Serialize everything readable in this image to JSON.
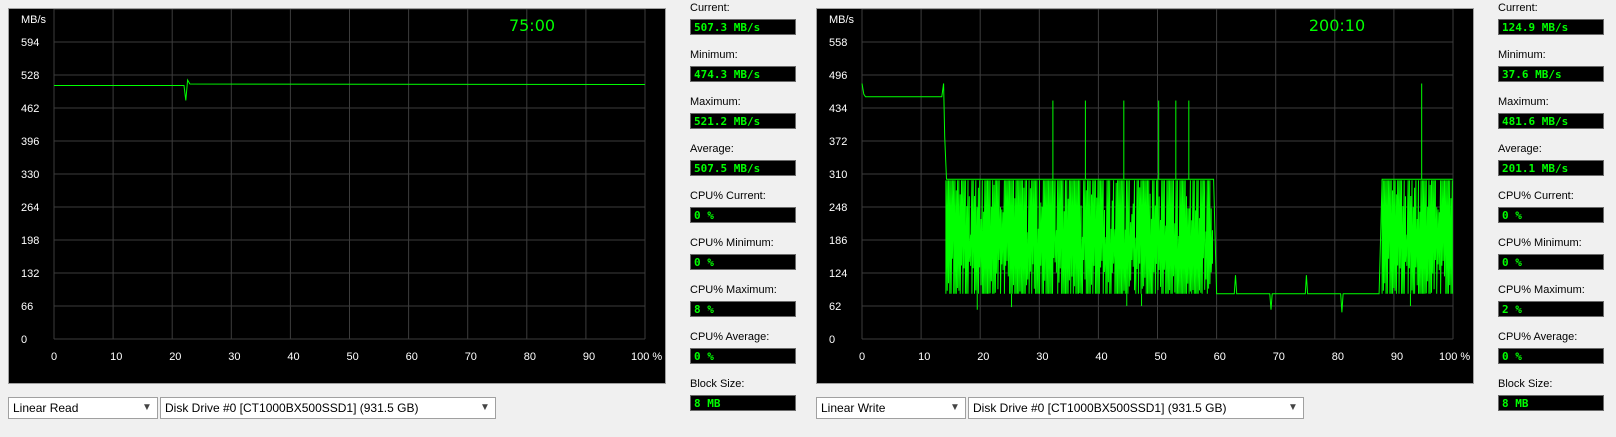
{
  "panels": [
    {
      "timer": "75:00",
      "unit_label": "MB/s",
      "mode": "Linear Read",
      "drive": "Disk Drive #0  [CT1000BX500SSD1]  (931.5 GB)",
      "stats": [
        {
          "label": "Current:",
          "value": "507.3 MB/s"
        },
        {
          "label": "Minimum:",
          "value": "474.3 MB/s"
        },
        {
          "label": "Maximum:",
          "value": "521.2 MB/s"
        },
        {
          "label": "Average:",
          "value": "507.5 MB/s"
        },
        {
          "label": "CPU% Current:",
          "value": "0 %"
        },
        {
          "label": "CPU% Minimum:",
          "value": "0 %"
        },
        {
          "label": "CPU% Maximum:",
          "value": "8 %"
        },
        {
          "label": "CPU% Average:",
          "value": "0 %"
        },
        {
          "label": "Block Size:",
          "value": "8 MB"
        }
      ]
    },
    {
      "timer": "200:10",
      "unit_label": "MB/s",
      "mode": "Linear Write",
      "drive": "Disk Drive #0  [CT1000BX500SSD1]  (931.5 GB)",
      "stats": [
        {
          "label": "Current:",
          "value": "124.9 MB/s"
        },
        {
          "label": "Minimum:",
          "value": "37.6 MB/s"
        },
        {
          "label": "Maximum:",
          "value": "481.6 MB/s"
        },
        {
          "label": "Average:",
          "value": "201.1 MB/s"
        },
        {
          "label": "CPU% Current:",
          "value": "0 %"
        },
        {
          "label": "CPU% Minimum:",
          "value": "0 %"
        },
        {
          "label": "CPU% Maximum:",
          "value": "2 %"
        },
        {
          "label": "CPU% Average:",
          "value": "0 %"
        },
        {
          "label": "Block Size:",
          "value": "8 MB"
        }
      ]
    }
  ],
  "chart_data": [
    {
      "type": "line",
      "ylabel": "MB/s",
      "ylim": [
        0,
        660
      ],
      "yticks": [
        "0",
        "66",
        "132",
        "198",
        "264",
        "330",
        "396",
        "462",
        "528",
        "594"
      ],
      "xlim": [
        0,
        100
      ],
      "xticks": [
        "0",
        "10",
        "20",
        "30",
        "40",
        "50",
        "60",
        "70",
        "80",
        "90",
        "100 %"
      ],
      "grid": true,
      "line_color": "#00ff00",
      "series": [
        {
          "x": [
            0,
            22,
            22.3,
            22.6,
            23,
            100
          ],
          "y": [
            507,
            507,
            477,
            518,
            510,
            509
          ]
        }
      ]
    },
    {
      "type": "line",
      "ylabel": "MB/s",
      "ylim": [
        0,
        620
      ],
      "yticks": [
        "0",
        "62",
        "124",
        "186",
        "248",
        "310",
        "372",
        "434",
        "496",
        "558"
      ],
      "xlim": [
        0,
        100
      ],
      "xticks": [
        "0",
        "10",
        "20",
        "30",
        "40",
        "50",
        "60",
        "70",
        "80",
        "90",
        "100 %"
      ],
      "grid": true,
      "line_color": "#00ff00",
      "series": [
        {
          "x": [
            0,
            0.3,
            0.6,
            13.5,
            13.8,
            14,
            14.3,
            59.5,
            60,
            63,
            63.2,
            63.4,
            69,
            69.2,
            69.4,
            75,
            75.2,
            75.4,
            81,
            81.2,
            81.4,
            87.5,
            88,
            100
          ],
          "y": [
            480,
            460,
            455,
            455,
            480,
            380,
            300,
            300,
            85,
            85,
            120,
            85,
            85,
            55,
            85,
            85,
            120,
            85,
            85,
            50,
            85,
            85,
            300,
            300
          ]
        }
      ],
      "oscillating_regions": [
        {
          "x_from": 14.2,
          "x_to": 59.5,
          "low": 85,
          "high": 298
        },
        {
          "x_from": 88,
          "x_to": 100,
          "low": 85,
          "high": 298
        }
      ],
      "spikes": [
        {
          "x": 32.3,
          "y": 448
        },
        {
          "x": 37.8,
          "y": 448
        },
        {
          "x": 44.3,
          "y": 448
        },
        {
          "x": 50.2,
          "y": 448
        },
        {
          "x": 53.1,
          "y": 448
        },
        {
          "x": 55.3,
          "y": 448
        },
        {
          "x": 94.7,
          "y": 480
        }
      ],
      "dips": [
        {
          "x": 19.5,
          "y": 55
        },
        {
          "x": 25.3,
          "y": 60
        },
        {
          "x": 44.8,
          "y": 62
        },
        {
          "x": 47.3,
          "y": 62
        },
        {
          "x": 92.8,
          "y": 62
        }
      ]
    }
  ]
}
